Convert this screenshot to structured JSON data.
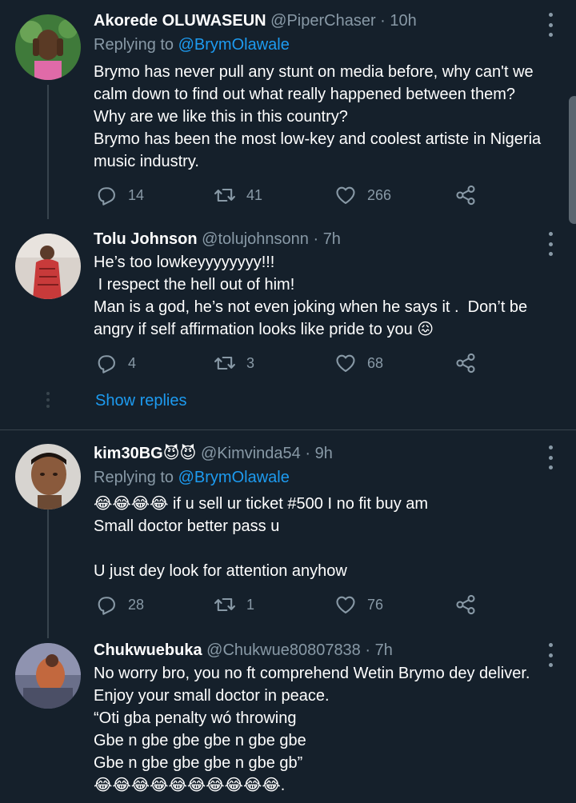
{
  "tweets": [
    {
      "name": "Akorede OLUWASEUN",
      "handle": "@PiperChaser",
      "time": "10h",
      "replying_prefix": "Replying to ",
      "replying_to": "@BrymOlawale",
      "text": "Brymo has never pull any stunt on media before, why can't we calm down to find out what really happened between them?\nWhy are we like this in this country?\nBrymo has been the most low-key and coolest artiste in Nigeria music industry.",
      "replies": "14",
      "retweets": "41",
      "likes": "266"
    },
    {
      "name": "Tolu Johnson",
      "handle": "@tolujohnsonn",
      "time": "7h",
      "text": "He’s too lowkeyyyyyyyy!!!\n I respect the hell out of him!\nMan is a god, he’s not even joking when he says it .  Don’t be angry if self affirmation looks like pride to you 😖",
      "replies": "4",
      "retweets": "3",
      "likes": "68",
      "show_replies": "Show replies"
    },
    {
      "name": "kim30BG😈😈",
      "handle": "@Kimvinda54",
      "time": "9h",
      "replying_prefix": "Replying to ",
      "replying_to": "@BrymOlawale",
      "text": "😂😂😂😂 if u sell ur ticket #500 I no fit buy am\nSmall doctor better pass u\n\nU just dey look for attention anyhow",
      "replies": "28",
      "retweets": "1",
      "likes": "76"
    },
    {
      "name": "Chukwuebuka",
      "handle": "@Chukwue80807838",
      "time": "7h",
      "text": "No worry bro, you no ft comprehend Wetin Brymo dey deliver.\nEnjoy your small doctor in peace.\n“Oti gba penalty wó throwing\nGbe n gbe gbe gbe n gbe gbe\nGbe n gbe gbe gbe n gbe gb”\n😂😂😂😂😂😂😂😂😂😂."
    }
  ],
  "separator": " · ",
  "icons": [
    "more-icon",
    "reply-icon",
    "retweet-icon",
    "like-icon",
    "share-icon"
  ],
  "colors": {
    "background": "#15202b",
    "muted": "#8899a6",
    "link": "#1d9bf0",
    "border": "#38444d"
  }
}
